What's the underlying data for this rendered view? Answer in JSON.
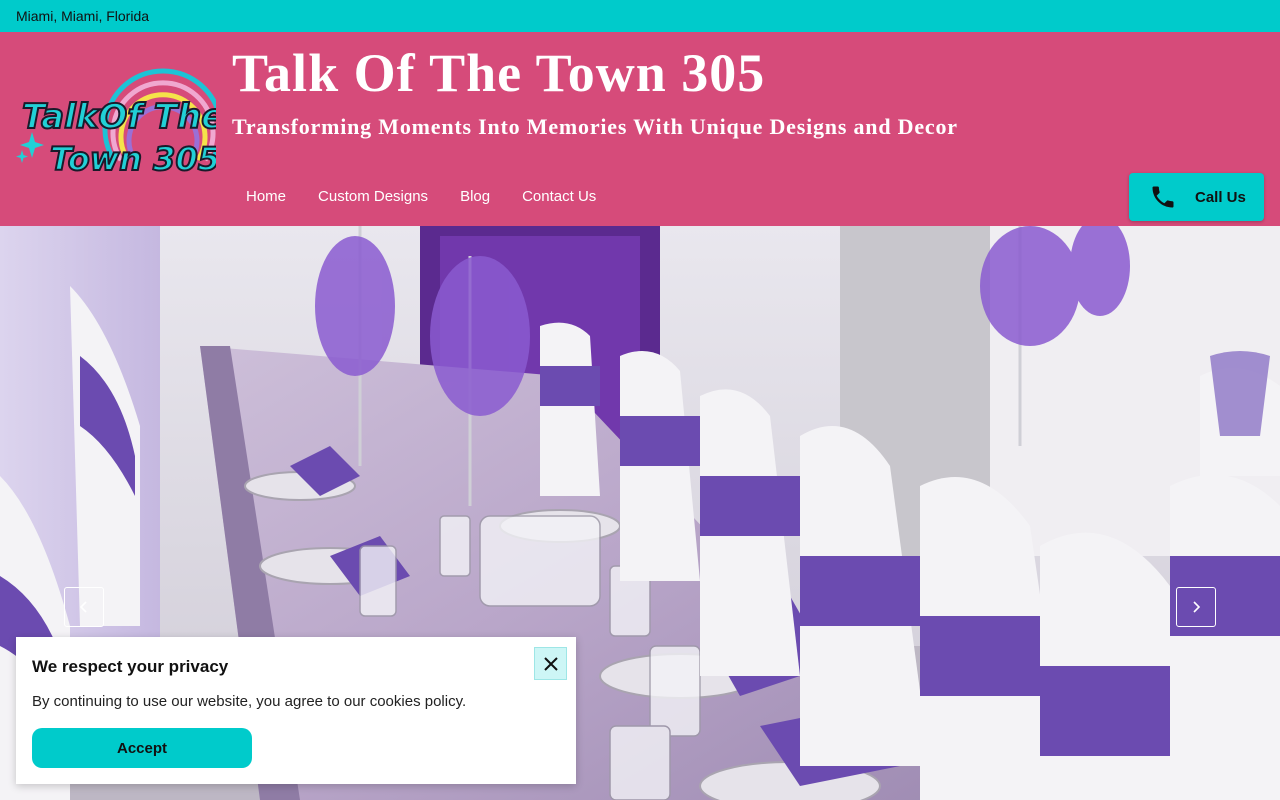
{
  "topbar": {
    "location": "Miami, Miami, Florida"
  },
  "header": {
    "logo_text_line1": "TalkOf The",
    "logo_text_line2": "Town 305",
    "title": "Talk Of The Town 305",
    "tagline": "Transforming Moments Into Memories With Unique Designs and Decor",
    "call_label": "Call Us",
    "call_icon": "phone-icon"
  },
  "nav": {
    "items": [
      {
        "label": "Home"
      },
      {
        "label": "Custom Designs"
      },
      {
        "label": "Blog"
      },
      {
        "label": "Contact Us"
      }
    ]
  },
  "slider": {
    "prev_icon": "chevron-left-icon",
    "next_icon": "chevron-right-icon"
  },
  "cookie": {
    "title": "We respect your privacy",
    "text": "By continuing to use our website, you agree to our cookies policy.",
    "accept_label": "Accept",
    "close_icon": "close-icon"
  },
  "colors": {
    "topbar": "#00cbcb",
    "header": "#d64b7a",
    "accent": "#00cbcb",
    "sash_purple": "#6b4bb0"
  }
}
